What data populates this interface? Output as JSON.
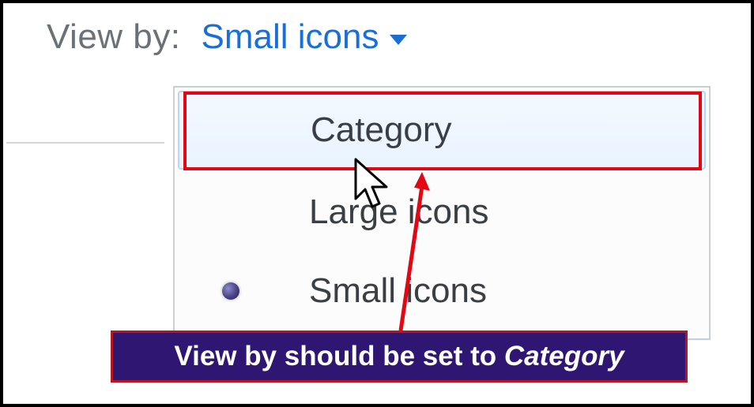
{
  "header": {
    "label": "View by:",
    "selected": "Small icons"
  },
  "menu": {
    "items": [
      {
        "label": "Category",
        "selected": false,
        "highlighted": true
      },
      {
        "label": "Large icons",
        "selected": false,
        "highlighted": false
      },
      {
        "label": "Small icons",
        "selected": true,
        "highlighted": false
      }
    ]
  },
  "callout": {
    "prefix": "View by should be set to ",
    "emphasis": "Category"
  },
  "colors": {
    "link": "#1a6fd6",
    "highlight_red": "#e30613",
    "callout_bg": "#2f1673",
    "callout_border": "#b41622"
  }
}
